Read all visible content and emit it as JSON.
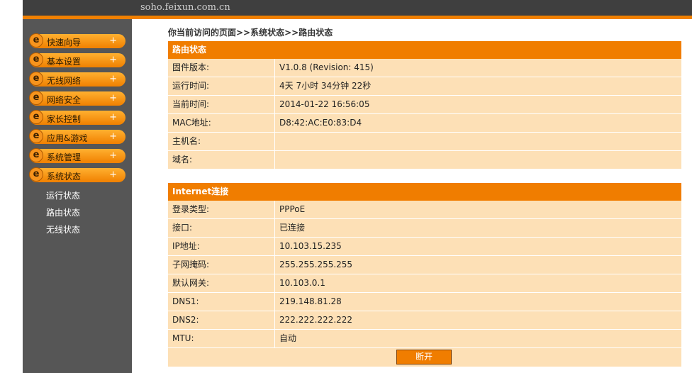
{
  "header": {
    "domain": "soho.feixun.com.cn"
  },
  "sidebar": {
    "menu": [
      {
        "label": "快速向导",
        "expand": "+"
      },
      {
        "label": "基本设置",
        "expand": "+"
      },
      {
        "label": "无线网络",
        "expand": "+"
      },
      {
        "label": "网络安全",
        "expand": "+"
      },
      {
        "label": "家长控制",
        "expand": "+"
      },
      {
        "label": "应用&游戏",
        "expand": "+"
      },
      {
        "label": "系统管理",
        "expand": "+"
      },
      {
        "label": "系统状态",
        "expand": "+"
      }
    ],
    "submenu": [
      "运行状态",
      "路由状态",
      "无线状态"
    ]
  },
  "breadcrumb": "你当前访问的页面>>系统状态>>路由状态",
  "router_status": {
    "title": "路由状态",
    "rows": [
      {
        "key": "固件版本:",
        "value": "V1.0.8 (Revision: 415)"
      },
      {
        "key": "运行时间:",
        "value": "4天  7小时  34分钟  22秒"
      },
      {
        "key": "当前时间:",
        "value": "2014-01-22 16:56:05"
      },
      {
        "key": "MAC地址:",
        "value": "D8:42:AC:E0:83:D4"
      },
      {
        "key": "主机名:",
        "value": ""
      },
      {
        "key": "域名:",
        "value": ""
      }
    ]
  },
  "internet": {
    "title": "Internet连接",
    "rows": [
      {
        "key": "登录类型:",
        "value": "PPPoE"
      },
      {
        "key": "接口:",
        "value": "已连接"
      },
      {
        "key": "IP地址:",
        "value": "10.103.15.235"
      },
      {
        "key": "子网掩码:",
        "value": "255.255.255.255"
      },
      {
        "key": "默认网关:",
        "value": "10.103.0.1"
      },
      {
        "key": "DNS1:",
        "value": "219.148.81.28"
      },
      {
        "key": "DNS2:",
        "value": "222.222.222.222"
      },
      {
        "key": "MTU:",
        "value": "自动"
      }
    ],
    "disconnect_label": "断开"
  }
}
